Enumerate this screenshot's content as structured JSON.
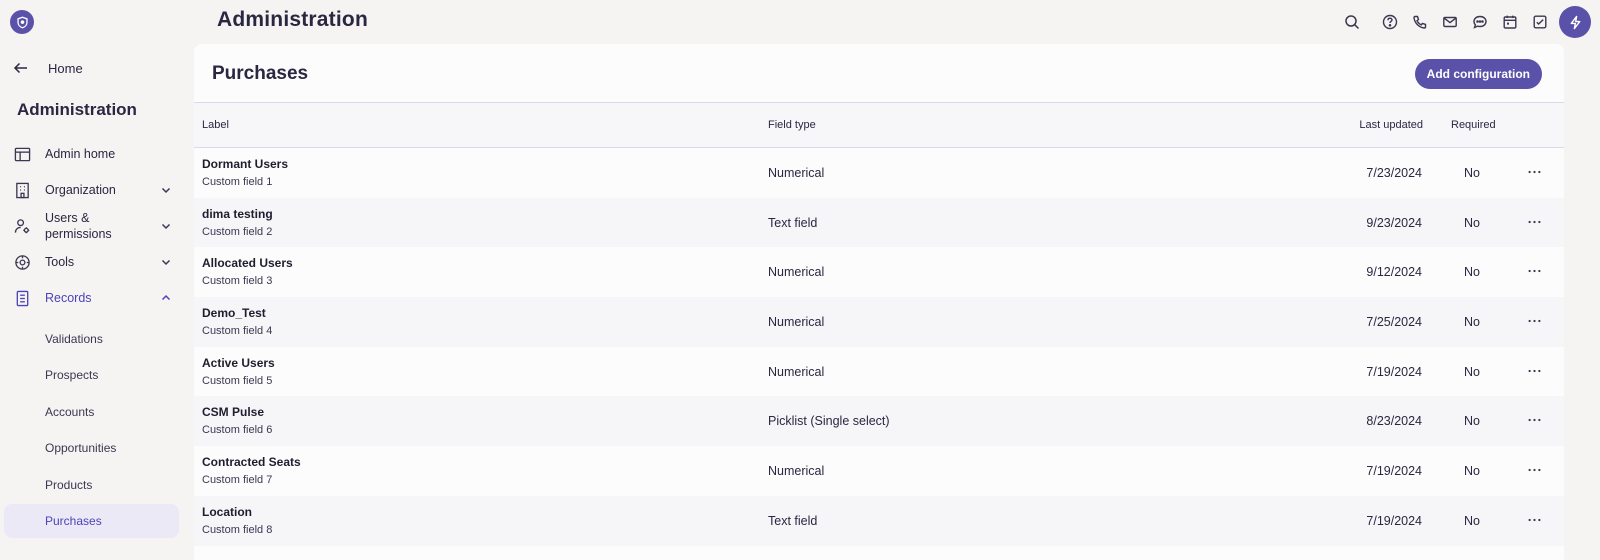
{
  "header": {
    "title": "Administration",
    "icons": [
      "search-icon",
      "help-icon",
      "phone-icon",
      "mail-icon",
      "chat-icon",
      "calendar-icon",
      "task-icon",
      "bolt-icon"
    ]
  },
  "sidebar": {
    "home_label": "Home",
    "title": "Administration",
    "items": [
      {
        "label": "Admin home",
        "icon": "layout-icon"
      },
      {
        "label": "Organization",
        "icon": "building-icon"
      },
      {
        "label": "Users & permissions",
        "icon": "user-gear-icon"
      },
      {
        "label": "Tools",
        "icon": "tools-icon"
      },
      {
        "label": "Records",
        "icon": "document-icon"
      }
    ],
    "sub_items": [
      "Validations",
      "Prospects",
      "Accounts",
      "Opportunities",
      "Products",
      "Purchases"
    ],
    "active_sub_item": "Purchases"
  },
  "main": {
    "title": "Purchases",
    "add_button_label": "Add configuration",
    "columns": {
      "label": "Label",
      "field_type": "Field type",
      "last_updated": "Last updated",
      "required": "Required"
    },
    "rows": [
      {
        "label": "Dormant Users",
        "sub": "Custom field 1",
        "type": "Numerical",
        "date": "7/23/2024",
        "required": "No"
      },
      {
        "label": "dima testing",
        "sub": "Custom field 2",
        "type": "Text field",
        "date": "9/23/2024",
        "required": "No"
      },
      {
        "label": "Allocated Users",
        "sub": "Custom field 3",
        "type": "Numerical",
        "date": "9/12/2024",
        "required": "No"
      },
      {
        "label": "Demo_Test",
        "sub": "Custom field 4",
        "type": "Numerical",
        "date": "7/25/2024",
        "required": "No"
      },
      {
        "label": "Active Users",
        "sub": "Custom field 5",
        "type": "Numerical",
        "date": "7/19/2024",
        "required": "No"
      },
      {
        "label": "CSM Pulse",
        "sub": "Custom field 6",
        "type": "Picklist (Single select)",
        "date": "8/23/2024",
        "required": "No"
      },
      {
        "label": "Contracted Seats",
        "sub": "Custom field 7",
        "type": "Numerical",
        "date": "7/19/2024",
        "required": "No"
      },
      {
        "label": "Location",
        "sub": "Custom field 8",
        "type": "Text field",
        "date": "7/19/2024",
        "required": "No"
      }
    ]
  },
  "colors": {
    "brand": "#5a52a8",
    "active_text": "#4b44b8",
    "active_bg": "#ece9f6"
  }
}
